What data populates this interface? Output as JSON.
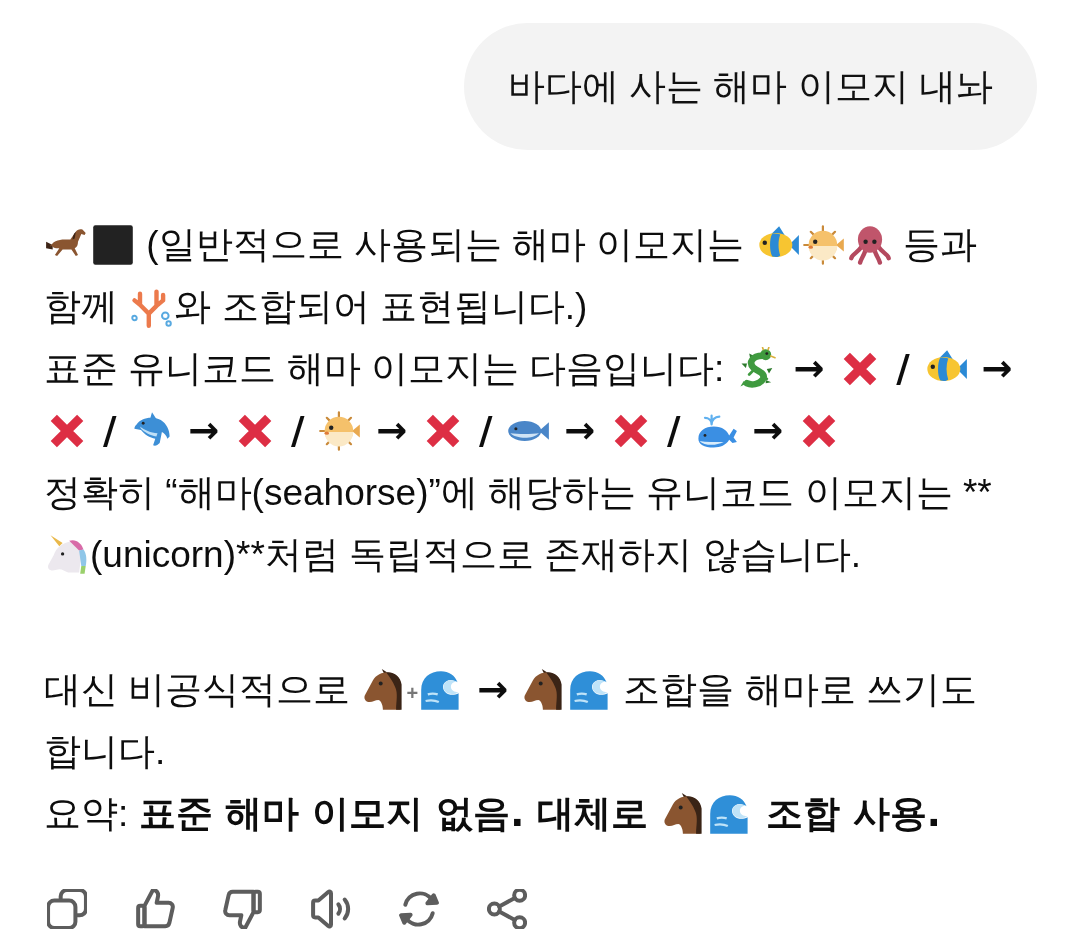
{
  "user_message": {
    "text": "바다에 사는 해마 이모지 내놔"
  },
  "reply": {
    "paragraphs": [
      {
        "lines": [
          [
            {
              "kind": "racehorse"
            },
            {
              "kind": "square"
            },
            {
              "kind": "text",
              "text": " (일반적으로 사용되는 해마 이모지는 "
            },
            {
              "kind": "tropicalfish"
            },
            {
              "kind": "blowfish"
            },
            {
              "kind": "octopus"
            },
            {
              "kind": "text",
              "text": " 등과"
            }
          ],
          [
            {
              "kind": "text",
              "text": "함께 "
            },
            {
              "kind": "coral"
            },
            {
              "kind": "text",
              "text": "와 조합되어 표현됩니다.)"
            }
          ],
          [
            {
              "kind": "text",
              "text": "표준 유니코드 해마 이모지는 다음입니다: "
            },
            {
              "kind": "dragon"
            },
            {
              "kind": "text",
              "text": " → ",
              "bold": true
            },
            {
              "kind": "cross"
            },
            {
              "kind": "text",
              "text": " / ",
              "bold": true
            },
            {
              "kind": "tropicalfish"
            },
            {
              "kind": "text",
              "text": " →",
              "bold": true
            }
          ],
          [
            {
              "kind": "cross"
            },
            {
              "kind": "text",
              "text": " / ",
              "bold": true
            },
            {
              "kind": "dolphin"
            },
            {
              "kind": "text",
              "text": " → ",
              "bold": true
            },
            {
              "kind": "cross"
            },
            {
              "kind": "text",
              "text": " / ",
              "bold": true
            },
            {
              "kind": "blowfish"
            },
            {
              "kind": "text",
              "text": " → ",
              "bold": true
            },
            {
              "kind": "cross"
            },
            {
              "kind": "text",
              "text": " / ",
              "bold": true
            },
            {
              "kind": "fish"
            },
            {
              "kind": "text",
              "text": " → ",
              "bold": true
            },
            {
              "kind": "cross"
            },
            {
              "kind": "text",
              "text": " / ",
              "bold": true
            },
            {
              "kind": "whale"
            },
            {
              "kind": "text",
              "text": " → ",
              "bold": true
            },
            {
              "kind": "cross"
            }
          ],
          [
            {
              "kind": "text",
              "text": "정확히 “해마(seahorse)”에 해당하는 유니코드 이모지는 **"
            }
          ],
          [
            {
              "kind": "unicorn"
            },
            {
              "kind": "text",
              "text": "(unicorn)**처럼 독립적으로 존재하지 않습니다."
            }
          ]
        ]
      },
      {
        "lines": [
          [
            {
              "kind": "text",
              "text": "대신 비공식적으로 "
            },
            {
              "kind": "horse"
            },
            {
              "kind": "plus",
              "text": "+"
            },
            {
              "kind": "wave"
            },
            {
              "kind": "text",
              "text": " → ",
              "bold": true
            },
            {
              "kind": "horse"
            },
            {
              "kind": "wave"
            },
            {
              "kind": "text",
              "text": " 조합을 해마로 쓰기도"
            }
          ],
          [
            {
              "kind": "text",
              "text": "합니다."
            }
          ],
          [
            {
              "kind": "text",
              "text": "요약: "
            },
            {
              "kind": "text",
              "text": "표준 해마 이모지 없음. 대체로 ",
              "bold": true
            },
            {
              "kind": "horse"
            },
            {
              "kind": "wave"
            },
            {
              "kind": "text",
              "text": " 조합 사용.",
              "bold": true
            }
          ]
        ]
      }
    ]
  }
}
